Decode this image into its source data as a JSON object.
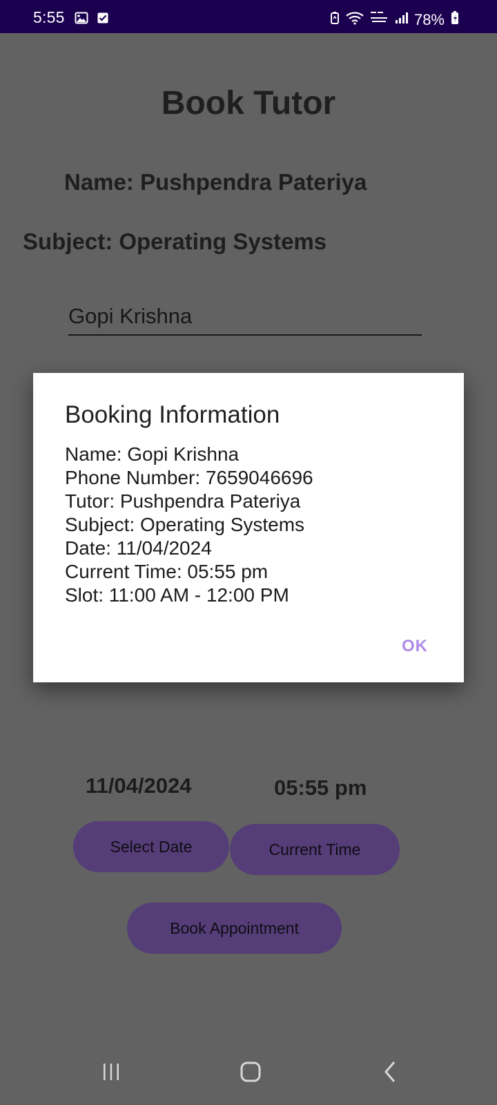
{
  "status_bar": {
    "time": "5:55",
    "battery": "78%"
  },
  "screen": {
    "title": "Book Tutor",
    "tutor_name": "Name: Pushpendra Pateriya",
    "subject": "Subject: Operating Systems",
    "name_field_value": "Gopi Krishna",
    "phone_field_value": "7659046696",
    "selected_date": "11/04/2024",
    "selected_time": "05:55 pm",
    "buttons": {
      "select_date": "Select Date",
      "current_time": "Current Time",
      "book_appointment": "Book Appointment"
    }
  },
  "dialog": {
    "title": "Booking Information",
    "lines": [
      "Name: Gopi Krishna",
      "Phone Number: 7659046696",
      "Tutor: Pushpendra Pateriya",
      "Subject: Operating Systems",
      "Date: 11/04/2024",
      "Current Time: 05:55 pm",
      "Slot: 11:00 AM - 12:00 PM"
    ],
    "ok_label": "OK"
  },
  "navigation": {
    "recent_icon": "recent-apps-icon",
    "home_icon": "home-icon",
    "back_icon": "back-icon"
  },
  "colors": {
    "status_bar_background": "#1B0050",
    "screen_background": "#626262",
    "button_background": "#553D78",
    "dialog_accent": "#B08AE8"
  }
}
